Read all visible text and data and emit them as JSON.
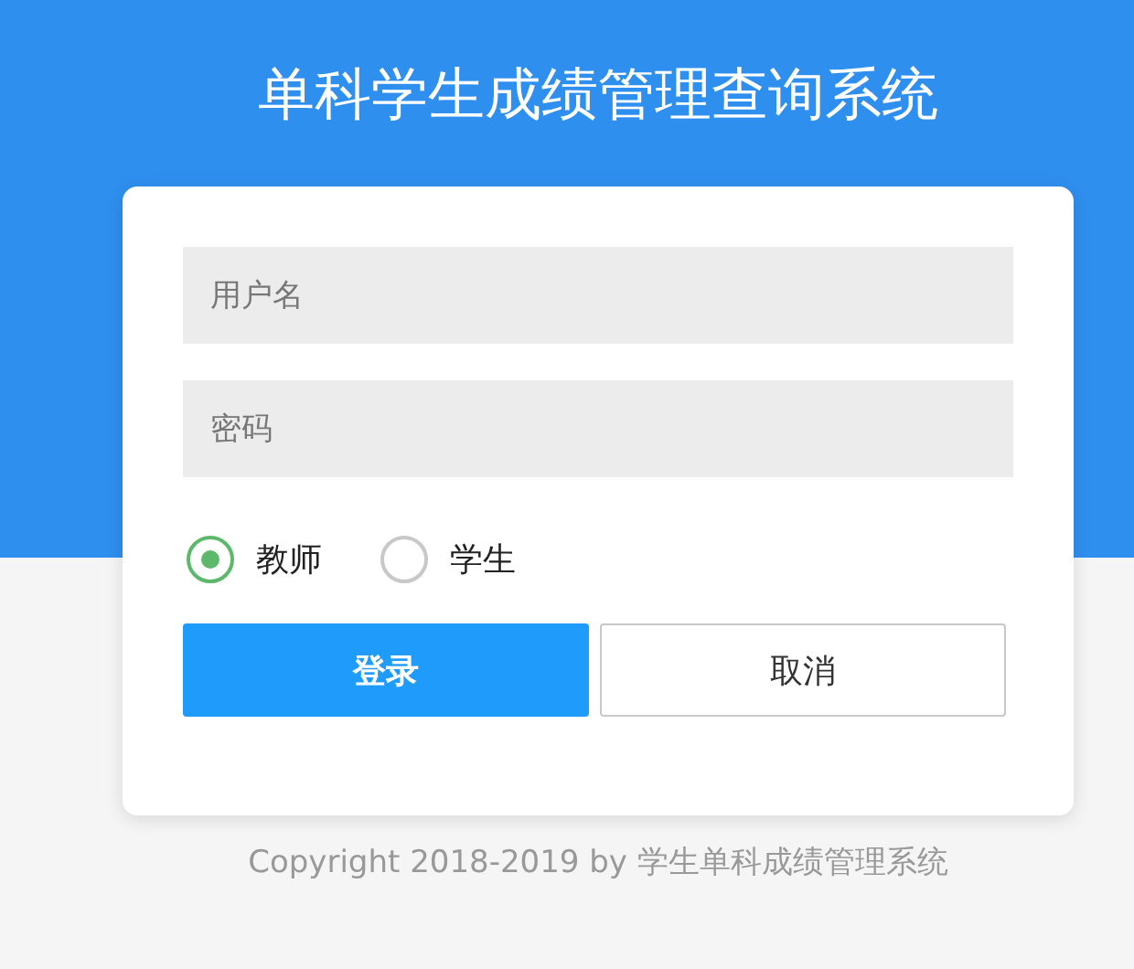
{
  "title": "单科学生成绩管理查询系统",
  "form": {
    "username": {
      "placeholder": "用户名"
    },
    "password": {
      "placeholder": "密码"
    },
    "roles": [
      {
        "label": "教师",
        "selected": true
      },
      {
        "label": "学生",
        "selected": false
      }
    ],
    "buttons": [
      {
        "kind": "primary",
        "label": "登录"
      },
      {
        "kind": "secondary",
        "label": "取消"
      }
    ]
  },
  "footer": "Copyright 2018-2019 by 学生单科成绩管理系统"
}
